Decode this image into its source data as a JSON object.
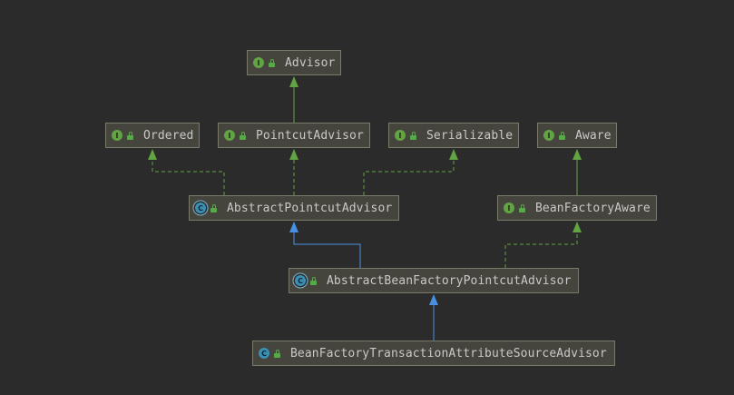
{
  "colors": {
    "background": "#2b2b2b",
    "node_fill": "#45443d",
    "node_border": "#7a7a6a",
    "interface_badge": "#62a344",
    "class_badge": "#3b8fb3",
    "realization_edge": "#62a344",
    "inheritance_edge": "#4a90e2"
  },
  "nodes": {
    "advisor": {
      "label": "Advisor",
      "badge": "I",
      "kind": "interface"
    },
    "ordered": {
      "label": "Ordered",
      "badge": "I",
      "kind": "interface"
    },
    "pointcut_advisor": {
      "label": "PointcutAdvisor",
      "badge": "I",
      "kind": "interface"
    },
    "serializable": {
      "label": "Serializable",
      "badge": "I",
      "kind": "interface"
    },
    "aware": {
      "label": "Aware",
      "badge": "I",
      "kind": "interface"
    },
    "abstract_pointcut_advisor": {
      "label": "AbstractPointcutAdvisor",
      "badge": "C",
      "kind": "abstract-class"
    },
    "bean_factory_aware": {
      "label": "BeanFactoryAware",
      "badge": "I",
      "kind": "interface"
    },
    "abstract_bean_factory_pointcut_advisor": {
      "label": "AbstractBeanFactoryPointcutAdvisor",
      "badge": "C",
      "kind": "abstract-class"
    },
    "bean_factory_transaction_attribute_source_advisor": {
      "label": "BeanFactoryTransactionAttributeSourceAdvisor",
      "badge": "C",
      "kind": "class"
    }
  },
  "edges": [
    {
      "from": "pointcut_advisor",
      "to": "advisor",
      "kind": "extends-interface"
    },
    {
      "from": "bean_factory_aware",
      "to": "aware",
      "kind": "extends-interface"
    },
    {
      "from": "abstract_pointcut_advisor",
      "to": "ordered",
      "kind": "implements"
    },
    {
      "from": "abstract_pointcut_advisor",
      "to": "pointcut_advisor",
      "kind": "implements"
    },
    {
      "from": "abstract_pointcut_advisor",
      "to": "serializable",
      "kind": "implements"
    },
    {
      "from": "abstract_bean_factory_pointcut_advisor",
      "to": "abstract_pointcut_advisor",
      "kind": "extends-class"
    },
    {
      "from": "abstract_bean_factory_pointcut_advisor",
      "to": "bean_factory_aware",
      "kind": "implements"
    },
    {
      "from": "bean_factory_transaction_attribute_source_advisor",
      "to": "abstract_bean_factory_pointcut_advisor",
      "kind": "extends-class"
    }
  ]
}
